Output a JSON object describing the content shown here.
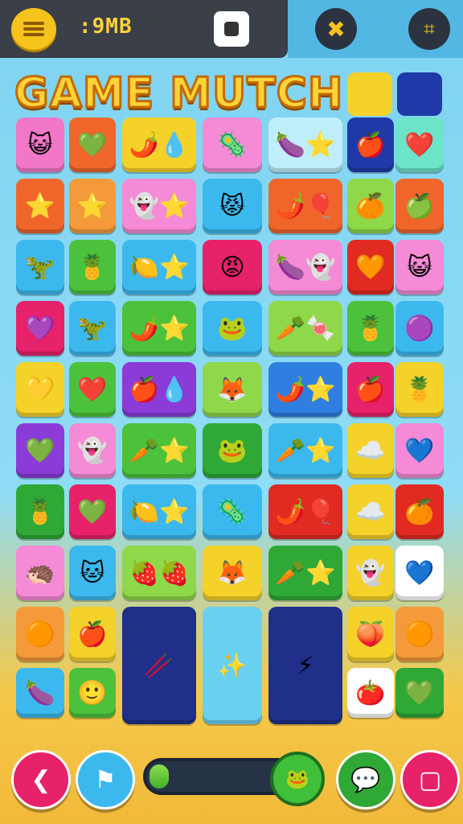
{
  "header": {
    "score_text": ":9MB",
    "menu_icon": "hamburger-menu-icon",
    "camera_icon": "camera-icon",
    "tool_icon_1": "bone-wrench-icon",
    "tool_icon_2": "frame-scan-icon"
  },
  "title": {
    "text": "GAME MUTCH"
  },
  "board": {
    "tiles": [
      {
        "color": "#f277c9",
        "icon": "😺"
      },
      {
        "color": "#f0662a",
        "icon": "💚"
      },
      {
        "color": "#f4d22a",
        "icon": "🌶️💧"
      },
      {
        "color": "#f58ad6",
        "icon": "🦠"
      },
      {
        "color": "#bfeefa",
        "icon": "🍆⭐"
      },
      {
        "color": "#1f3aa8",
        "icon": "🍎"
      },
      {
        "color": "#6ce4c8",
        "icon": "❤️"
      },
      {
        "color": "#f0662a",
        "icon": "⭐"
      },
      {
        "color": "#f49a3a",
        "icon": "⭐"
      },
      {
        "color": "#f58ad6",
        "icon": "👻⭐"
      },
      {
        "color": "#3bb9ee",
        "icon": "😾"
      },
      {
        "color": "#f0662a",
        "icon": "🌶️🎈"
      },
      {
        "color": "#8ed84a",
        "icon": "🍊"
      },
      {
        "color": "#f0662a",
        "icon": "🍏"
      },
      {
        "color": "#3bb9ee",
        "icon": "🦖"
      },
      {
        "color": "#4cc23c",
        "icon": "🍍"
      },
      {
        "color": "#3bb9ee",
        "icon": "🍋⭐"
      },
      {
        "color": "#e7216a",
        "icon": "😡"
      },
      {
        "color": "#f58ad6",
        "icon": "🍆👻"
      },
      {
        "color": "#e02a22",
        "icon": "🧡"
      },
      {
        "color": "#f58ad6",
        "icon": "😺"
      },
      {
        "color": "#e7216a",
        "icon": "💜"
      },
      {
        "color": "#3bb9ee",
        "icon": "🦖"
      },
      {
        "color": "#4cc23c",
        "icon": "🌶️⭐"
      },
      {
        "color": "#3bb9ee",
        "icon": "🐸"
      },
      {
        "color": "#8ed84a",
        "icon": "🥕🍬"
      },
      {
        "color": "#4cc23c",
        "icon": "🍍"
      },
      {
        "color": "#3bb9ee",
        "icon": "🟣"
      },
      {
        "color": "#f4d22a",
        "icon": "💛"
      },
      {
        "color": "#4cc23c",
        "icon": "❤️"
      },
      {
        "color": "#8a3bd8",
        "icon": "🍎💧"
      },
      {
        "color": "#8ed84a",
        "icon": "🦊"
      },
      {
        "color": "#2f7fe0",
        "icon": "🌶️⭐"
      },
      {
        "color": "#e7216a",
        "icon": "🍎"
      },
      {
        "color": "#f4d22a",
        "icon": "🍍"
      },
      {
        "color": "#8a3bd8",
        "icon": "💚"
      },
      {
        "color": "#f58ad6",
        "icon": "👻"
      },
      {
        "color": "#4cc23c",
        "icon": "🥕⭐"
      },
      {
        "color": "#2fa836",
        "icon": "🐸"
      },
      {
        "color": "#3bb9ee",
        "icon": "🥕⭐"
      },
      {
        "color": "#f4d22a",
        "icon": "☁️"
      },
      {
        "color": "#f58ad6",
        "icon": "💙"
      },
      {
        "color": "#2fa836",
        "icon": "🍍"
      },
      {
        "color": "#e7216a",
        "icon": "💚"
      },
      {
        "color": "#3bb9ee",
        "icon": "🍋⭐"
      },
      {
        "color": "#3bb9ee",
        "icon": "🦠"
      },
      {
        "color": "#e02a22",
        "icon": "🌶️🎈"
      },
      {
        "color": "#f4d22a",
        "icon": "☁️"
      },
      {
        "color": "#e02a22",
        "icon": "🍊"
      },
      {
        "color": "#f58ad6",
        "icon": "🦔"
      },
      {
        "color": "#3bb9ee",
        "icon": "🐱"
      },
      {
        "color": "#8ed84a",
        "icon": "🍓🍓"
      },
      {
        "color": "#f4d22a",
        "icon": "🦊"
      },
      {
        "color": "#2fa836",
        "icon": "🥕⭐"
      },
      {
        "color": "#f4d22a",
        "icon": "👻"
      },
      {
        "color": "#ffffff",
        "icon": "💙"
      },
      {
        "color": "#f49a3a",
        "icon": "🟠"
      },
      {
        "color": "#f4d22a",
        "icon": "🍎"
      },
      {
        "color": "#1f2f8a",
        "icon": "🥢"
      },
      {
        "color": "#6ad0f0",
        "icon": "✨"
      },
      {
        "color": "#1f2f8a",
        "icon": "⚡"
      },
      {
        "color": "#f4d22a",
        "icon": "🍑"
      },
      {
        "color": "#f49a3a",
        "icon": "🟠"
      },
      {
        "color": "#3bb9ee",
        "icon": "🍆"
      },
      {
        "color": "#4cc23c",
        "icon": "🙂"
      },
      {
        "color": "#ffffff",
        "icon": "🍅"
      },
      {
        "color": "#2fa836",
        "icon": "💚"
      }
    ]
  },
  "footer": {
    "back_icon": "back-arrow-icon",
    "flag_icon": "flag-icon",
    "chat_icon": "speech-bubble-icon",
    "note_icon": "note-icon",
    "progress_fraction": 0.12
  }
}
